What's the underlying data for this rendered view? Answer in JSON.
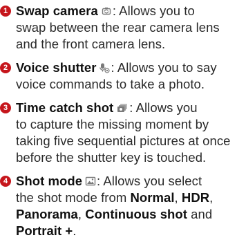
{
  "items": [
    {
      "number": "1",
      "title": "Swap camera",
      "icon": "swap-camera-icon",
      "text_l1": ": Allows you to",
      "text_l2": "swap between the rear camera lens",
      "text_l3": "and the front camera lens."
    },
    {
      "number": "2",
      "title": "Voice shutter",
      "icon": "voice-shutter-icon",
      "text_l1": ": Allows you to say",
      "text_l2": "voice commands to take a photo."
    },
    {
      "number": "3",
      "title": "Time catch shot",
      "icon": "time-catch-shot-icon",
      "text_l1": ": Allows you",
      "text_l2": "to capture the missing moment by",
      "text_l3": "taking five sequential pictures at once",
      "text_l4": "before the shutter key is touched."
    },
    {
      "number": "4",
      "title": "Shot mode",
      "icon": "shot-mode-icon",
      "text_l1": ": Allows you select",
      "text_l2a": "the shot mode from ",
      "opt_normal": "Normal",
      "sep1": ", ",
      "opt_hdr": "HDR",
      "sep2": ",",
      "opt_panorama": "Panorama",
      "sep3": ", ",
      "opt_continuous": "Continuous shot",
      "sep4": " and",
      "opt_portrait": "Portrait +",
      "end": "."
    }
  ],
  "colors": {
    "badge": "#c6161c",
    "text": "#2a2a2a",
    "icon": "#7a7a7a"
  }
}
